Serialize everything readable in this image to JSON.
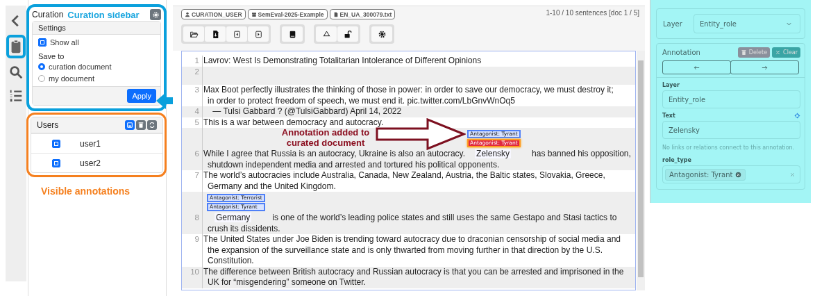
{
  "icon_bar": [
    {
      "kind": "back"
    },
    {
      "kind": "clipboard",
      "selected": true
    },
    {
      "kind": "search"
    },
    {
      "kind": "list"
    }
  ],
  "sidebar": {
    "title": "Curation",
    "callout": "Curation sidebar",
    "settings": {
      "title": "Settings",
      "show_all": {
        "label": "Show all",
        "checked": true
      },
      "save_to_label": "Save to",
      "options": [
        {
          "label": "curation document",
          "selected": true
        },
        {
          "label": "my document",
          "selected": false
        }
      ],
      "apply": "Apply"
    },
    "users": {
      "title": "Users",
      "items": [
        {
          "name": "user1",
          "checked": true
        },
        {
          "name": "user2",
          "checked": true
        }
      ]
    },
    "users_callout": "Visible annotations"
  },
  "toolbar": {
    "badges": [
      {
        "kind": "user",
        "text": "CURATION_USER"
      },
      {
        "kind": "project",
        "text": "SemEval-2025-Example"
      },
      {
        "kind": "file",
        "text": "EN_UA_300079.txt"
      }
    ],
    "page_info": "1-10 / 10 sentences [doc 1 / 5]"
  },
  "editor": {
    "callout": "Annotation added to curated document",
    "sentences": [
      {
        "number": "1",
        "lines": [
          [
            {
              "text": "Lavrov: West Is Demonstrating Totalitarian Intolerance of Different Opinions"
            }
          ]
        ]
      },
      {
        "number": "2"
      },
      {
        "number": "3",
        "lines": [
          [
            {
              "text": "Max Boot perfectly illustrates the thinking of those in power: in order to save our democracy, we must destroy it;"
            }
          ],
          [
            {
              "text": "in order to protect freedom of speech, we must end it. pic.twitter.com/LbGnvWnOq5"
            }
          ]
        ]
      },
      {
        "number": "4",
        "lines": [
          [
            {
              "text": "    — Tulsi Gabbard ? (@TulsiGabbard) April 14, 2022"
            }
          ]
        ]
      },
      {
        "number": "5",
        "lines": [
          [
            {
              "text": "This is a war between democracy and autocracy."
            }
          ]
        ]
      },
      {
        "number": "6",
        "lines": [
          [
            {
              "text": "While I agree that Russia is an autocracy, Ukraine is also an autocracy."
            },
            {
              "text": "Zelensky",
              "labels": [
                {
                  "text": "Antagonist: Tyrant",
                  "kind": "user"
                },
                {
                  "text": "Antagonist: Tyrant",
                  "kind": "curated"
                }
              ]
            },
            {
              "text": "has banned his opposition,"
            }
          ],
          [
            {
              "text": "shutdown independent media and arrested and tortured his political opponents."
            }
          ]
        ]
      },
      {
        "number": "7",
        "lines": [
          [
            {
              "text": "The world’s autocracies include Australia, Canada, New Zealand, Austria, the Baltic states, Slovakia, Greece,"
            }
          ],
          [
            {
              "text": "Germany and the United Kingdom."
            }
          ]
        ]
      },
      {
        "number": "8",
        "lines": [
          [
            {
              "text": "Germany",
              "labels": [
                {
                  "text": "Antagonist: Terrorist",
                  "kind": "user"
                },
                {
                  "text": "Antagonist: Tyrant",
                  "kind": "user"
                }
              ]
            },
            {
              "text": "is one of the world’s leading police states and still uses the same Gestapo and Stasi tactics to"
            }
          ],
          [
            {
              "text": "crush its dissidents."
            }
          ]
        ]
      },
      {
        "number": "9",
        "lines": [
          [
            {
              "text": "The United States under Joe Biden is trending toward autocracy due to draconian censorship of social media and"
            }
          ],
          [
            {
              "text": "the expansion of the surveillance state and is only thwarted from moving further in that direction by the U.S."
            }
          ],
          [
            {
              "text": "Constitution."
            }
          ]
        ]
      },
      {
        "number": "10",
        "lines": [
          [
            {
              "text": "The difference between British autocracy and Russian autocracy is that you can be arrested and imprisoned in the"
            }
          ],
          [
            {
              "text": "UK for “misgendering” someone on Twitter."
            }
          ]
        ]
      }
    ]
  },
  "details": {
    "layer_select": {
      "label": "Layer",
      "value": "Entity_role"
    },
    "annotation": {
      "title": "Annotation",
      "delete": "Delete",
      "clear": "Clear",
      "fields": [
        {
          "label": "Layer",
          "value": "Entity_role"
        },
        {
          "label": "Text",
          "value": "Zelensky"
        }
      ],
      "note": "No links or relations connect to this annotation.",
      "features": [
        {
          "label": "role_type",
          "tags": [
            "Antagonist: Tyrant"
          ]
        }
      ]
    }
  }
}
